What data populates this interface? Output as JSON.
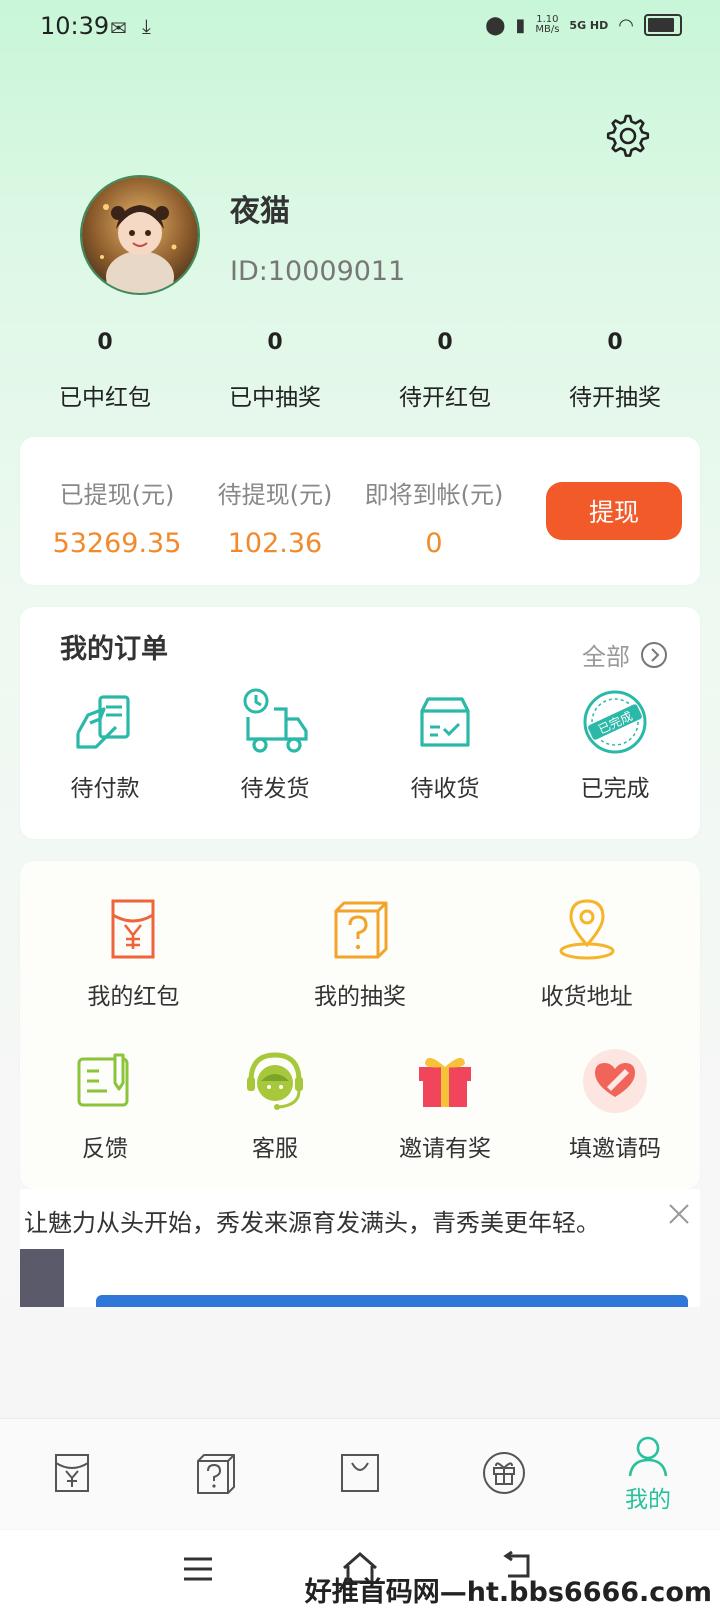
{
  "status_bar": {
    "time": "10:39",
    "speed_top": "1.10",
    "speed_unit": "MB/s",
    "network": "5G HD"
  },
  "profile": {
    "username": "夜猫",
    "user_id": "ID:10009011"
  },
  "stats": [
    {
      "value": "0",
      "label": "已中红包"
    },
    {
      "value": "0",
      "label": "已中抽奖"
    },
    {
      "value": "0",
      "label": "待开红包"
    },
    {
      "value": "0",
      "label": "待开抽奖"
    }
  ],
  "wallet": {
    "withdrawn_label": "已提现(元)",
    "withdrawn_value": "53269.35",
    "pending_label": "待提现(元)",
    "pending_value": "102.36",
    "arriving_label": "即将到帐(元)",
    "arriving_value": "0",
    "withdraw_button": "提现",
    "accent_color": "#f25a2a",
    "value_color": "#f08a2c"
  },
  "orders": {
    "title": "我的订单",
    "all_label": "全部",
    "items": [
      {
        "label": "待付款",
        "icon": "payment-icon"
      },
      {
        "label": "待发货",
        "icon": "delivery-truck-icon"
      },
      {
        "label": "待收货",
        "icon": "receive-box-icon"
      },
      {
        "label": "已完成",
        "icon": "completed-stamp-icon",
        "stamp_text": "已完成"
      }
    ]
  },
  "services": [
    {
      "label": "我的红包",
      "icon": "red-envelope-icon"
    },
    {
      "label": "我的抽奖",
      "icon": "lottery-box-icon"
    },
    {
      "label": "收货地址",
      "icon": "location-pin-icon"
    },
    {
      "label": "反馈",
      "icon": "feedback-icon"
    },
    {
      "label": "客服",
      "icon": "customer-service-icon"
    },
    {
      "label": "邀请有奖",
      "icon": "gift-icon"
    },
    {
      "label": "填邀请码",
      "icon": "invite-code-icon"
    }
  ],
  "ad": {
    "text": "让魅力从头开始，秀发来源育发满头，青秀美更年轻。"
  },
  "tabbar": {
    "accent_color": "#28c29a",
    "items": [
      {
        "label": "",
        "icon": "red-envelope-tab-icon"
      },
      {
        "label": "",
        "icon": "lottery-tab-icon"
      },
      {
        "label": "",
        "icon": "bag-tab-icon"
      },
      {
        "label": "",
        "icon": "gift-tab-icon"
      },
      {
        "label": "我的",
        "icon": "person-tab-icon"
      }
    ]
  },
  "watermark": "好推首码网—ht.bbs6666.com"
}
